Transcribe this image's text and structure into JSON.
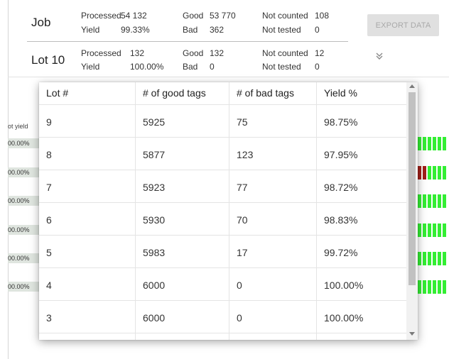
{
  "job": {
    "label": "Job",
    "processed_label": "Processed",
    "processed": "54 132",
    "yield_label": "Yield",
    "yield": "99.33%",
    "good_label": "Good",
    "good": "53 770",
    "bad_label": "Bad",
    "bad": "362",
    "not_counted_label": "Not counted",
    "not_counted": "108",
    "not_tested_label": "Not tested",
    "not_tested": "0"
  },
  "lot": {
    "label": "Lot 10",
    "processed_label": "Processed",
    "processed": "132",
    "yield_label": "Yield",
    "yield": "100.00%",
    "good_label": "Good",
    "good": "132",
    "bad_label": "Bad",
    "bad": "0",
    "not_counted_label": "Not counted",
    "not_counted": "12",
    "not_tested_label": "Not tested",
    "not_tested": "0"
  },
  "export_button": "EXPORT DATA",
  "expand_icon": "double-chevron-down-icon",
  "background_list": {
    "header": "ot yield",
    "cells": [
      "00.00%",
      "00.00%",
      "00.00%",
      "00.00%",
      "00.00%",
      "00.00%"
    ]
  },
  "popup_table": {
    "headers": [
      "Lot #",
      "# of good tags",
      "# of bad tags",
      "Yield %"
    ],
    "rows": [
      [
        "9",
        "5925",
        "75",
        "98.75%"
      ],
      [
        "8",
        "5877",
        "123",
        "97.95%"
      ],
      [
        "7",
        "5923",
        "77",
        "98.72%"
      ],
      [
        "6",
        "5930",
        "70",
        "98.83%"
      ],
      [
        "5",
        "5983",
        "17",
        "99.72%"
      ],
      [
        "4",
        "6000",
        "0",
        "100.00%"
      ],
      [
        "3",
        "6000",
        "0",
        "100.00%"
      ]
    ]
  },
  "colors": {
    "good_bar": "#33ee33",
    "bad_bar": "#a1201a",
    "button_bg": "#e0e0e0"
  }
}
